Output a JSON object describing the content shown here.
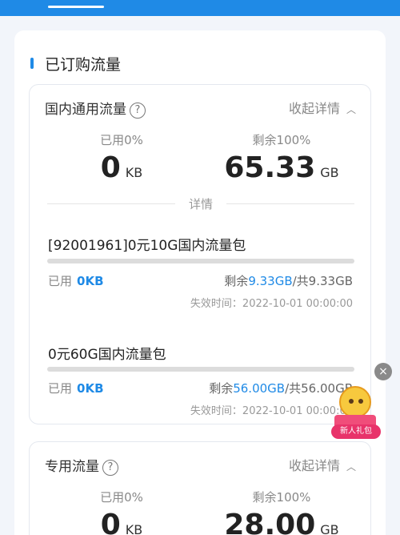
{
  "section_title": "已订购流量",
  "general": {
    "title": "国内通用流量",
    "collapse_label": "收起详情",
    "used_label": "已用0%",
    "used_value": "0",
    "used_unit": "KB",
    "remain_label": "剩余100%",
    "remain_value": "65.33",
    "remain_unit": "GB",
    "details_label": "详情",
    "packages": [
      {
        "name": "[92001961]0元10G国内流量包",
        "used_label": "已用",
        "used_value": "0KB",
        "remain_prefix": "剩余",
        "remain_value": "9.33GB",
        "remain_suffix": "/共9.33GB",
        "expire": "失效时间：2022-10-01 00:00:00",
        "progress": 0
      },
      {
        "name": "0元60G国内流量包",
        "used_label": "已用",
        "used_value": "0KB",
        "remain_prefix": "剩余",
        "remain_value": "56.00GB",
        "remain_suffix": "/共56.00GB",
        "expire": "失效时间：2022-10-01 00:00:00",
        "progress": 0
      }
    ]
  },
  "special": {
    "title": "专用流量",
    "collapse_label": "收起详情",
    "used_label": "已用0%",
    "used_value": "0",
    "used_unit": "KB",
    "remain_label": "剩余100%",
    "remain_value": "28.00",
    "remain_unit": "GB"
  },
  "gift_badge": "新人礼包",
  "close_icon": "×",
  "accent": "#1f8ae6"
}
